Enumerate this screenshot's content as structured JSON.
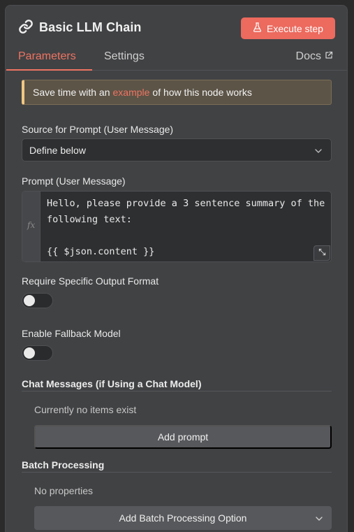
{
  "header": {
    "title": "Basic LLM Chain",
    "execute_label": "Execute step",
    "icons": {
      "node": "link-icon",
      "execute": "flask-icon"
    }
  },
  "tabs": {
    "items": [
      {
        "label": "Parameters",
        "active": true
      },
      {
        "label": "Settings",
        "active": false
      }
    ],
    "docs_label": "Docs"
  },
  "notice": {
    "prefix": "Save time with an",
    "link": "example",
    "suffix": "of how this node works"
  },
  "source": {
    "label": "Source for Prompt (User Message)",
    "value": "Define below"
  },
  "prompt": {
    "label": "Prompt (User Message)",
    "fx": "fx",
    "value": "Hello, please provide a 3 sentence summary of the following text:\n\n{{ $json.content }}"
  },
  "output_format": {
    "label": "Require Specific Output Format",
    "enabled": false
  },
  "fallback": {
    "label": "Enable Fallback Model",
    "enabled": false
  },
  "chat_messages": {
    "title": "Chat Messages (if Using a Chat Model)",
    "empty_text": "Currently no items exist",
    "add_label": "Add prompt"
  },
  "batch": {
    "title": "Batch Processing",
    "empty_text": "No properties",
    "add_label": "Add Batch Processing Option"
  },
  "colors": {
    "accent": "#ee7462",
    "execute_bg": "#ec6a5e",
    "panel_bg": "#414244",
    "notice_bar": "#f0c783"
  }
}
